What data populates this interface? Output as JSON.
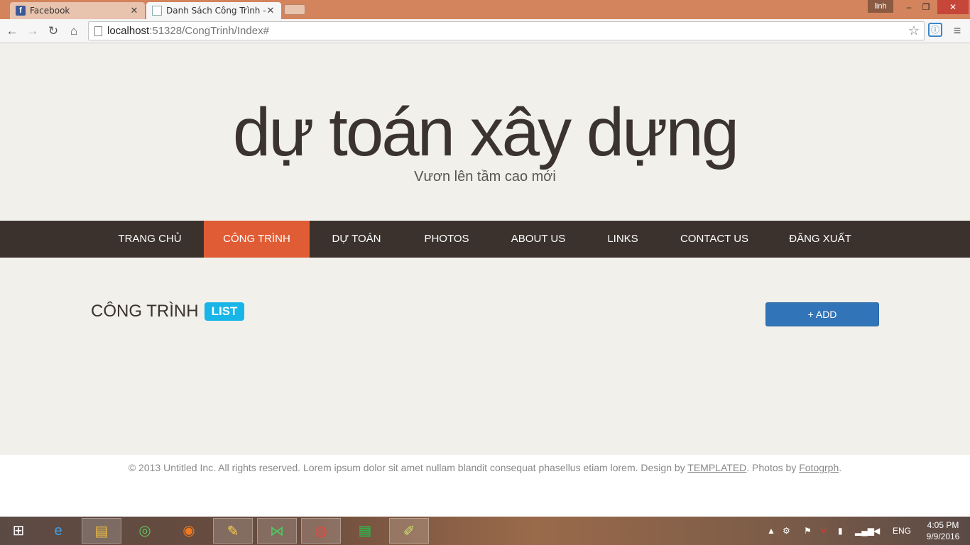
{
  "browser": {
    "tabs": [
      {
        "title": "Facebook",
        "active": false
      },
      {
        "title": "Danh Sách Công Trình - M",
        "active": true
      }
    ],
    "user": "linh",
    "window_controls": {
      "minimize": "–",
      "maximize": "❐",
      "close": "✕"
    },
    "nav": {
      "back": "←",
      "forward": "→",
      "reload": "↻",
      "home": "⌂"
    },
    "url_host": "localhost",
    "url_rest": ":51328/CongTrinh/Index#",
    "star": "☆",
    "menu": "≡"
  },
  "site": {
    "title": "dự toán xây dựng",
    "tagline": "Vươn lên tầm cao mới"
  },
  "nav": {
    "items": [
      {
        "label": "TRANG CHỦ",
        "active": false
      },
      {
        "label": "CÔNG TRÌNH",
        "active": true
      },
      {
        "label": "DỰ TOÁN",
        "active": false
      },
      {
        "label": "PHOTOS",
        "active": false
      },
      {
        "label": "ABOUT US",
        "active": false
      },
      {
        "label": "LINKS",
        "active": false
      },
      {
        "label": "CONTACT US",
        "active": false
      },
      {
        "label": "ĐĂNG XUẤT",
        "active": false
      }
    ]
  },
  "content": {
    "heading": "CÔNG TRÌNH",
    "badge": "LIST",
    "add_button": "+ ADD"
  },
  "footer": {
    "text_before": "© 2013 Untitled Inc. All rights reserved. Lorem ipsum dolor sit amet nullam blandit consequat phasellus etiam lorem. Design by ",
    "link1": "TEMPLATED",
    "text_middle": ". Photos by ",
    "link2": "Fotogrph",
    "text_after": "."
  },
  "taskbar": {
    "language": "ENG",
    "time": "4:05 PM",
    "date": "9/9/2016"
  },
  "colors": {
    "nav_bg": "#3b322d",
    "nav_active": "#e05c35",
    "badge": "#17b5e8",
    "button": "#3174b8"
  }
}
